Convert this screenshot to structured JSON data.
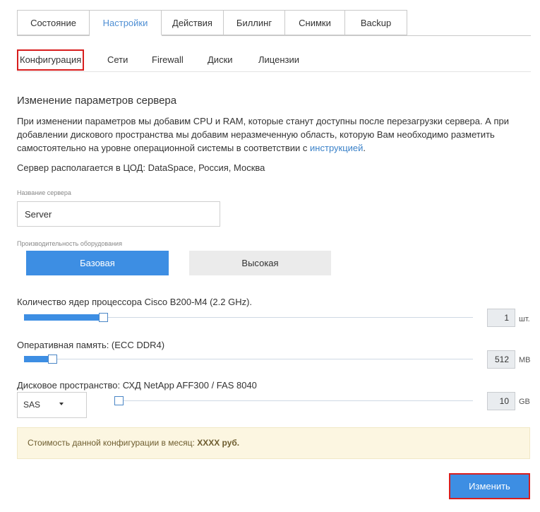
{
  "tabs": [
    "Состояние",
    "Настройки",
    "Действия",
    "Биллинг",
    "Снимки",
    "Backup"
  ],
  "active_tab_index": 1,
  "subnav": [
    "Конфигурация",
    "Сети",
    "Firewall",
    "Диски",
    "Лицензии"
  ],
  "active_subnav_index": 0,
  "section_title": "Изменение параметров сервера",
  "description_main": "При изменении параметров мы добавим CPU и RAM, которые станут доступны после перезагрузки сервера. А при добавлении дискового пространства мы добавим неразмеченную область, которую Вам необходимо разметить самостоятельно на уровне операционной системы в соответствии с ",
  "description_link": "инструкцией",
  "description_end": ".",
  "location": "Сервер располагается в ЦОД: DataSpace, Россия, Москва",
  "server_name": {
    "label": "Название сервера",
    "value": "Server"
  },
  "performance": {
    "label": "Производительность оборудования",
    "options": [
      "Базовая",
      "Высокая"
    ],
    "selected": "Базовая"
  },
  "cpu": {
    "label": "Количество ядер процессора Cisco B200-M4 (2.2 GHz).",
    "value": "1",
    "unit": "шт."
  },
  "ram": {
    "label": "Оперативная память: (ECC DDR4)",
    "value": "512",
    "unit": "MB"
  },
  "disk": {
    "label": "Дисковое пространство: СХД NetApp AFF300 / FAS 8040",
    "type": "SAS",
    "value": "10",
    "unit": "GB"
  },
  "cost": {
    "prefix": "Стоимость данной конфигурации в месяц: ",
    "amount": "XXXX руб."
  },
  "submit_label": "Изменить",
  "colors": {
    "accent": "#3d8ee3",
    "highlight": "#d81e1e",
    "notice_bg": "#fcf6e1",
    "link": "#3b82c9"
  }
}
